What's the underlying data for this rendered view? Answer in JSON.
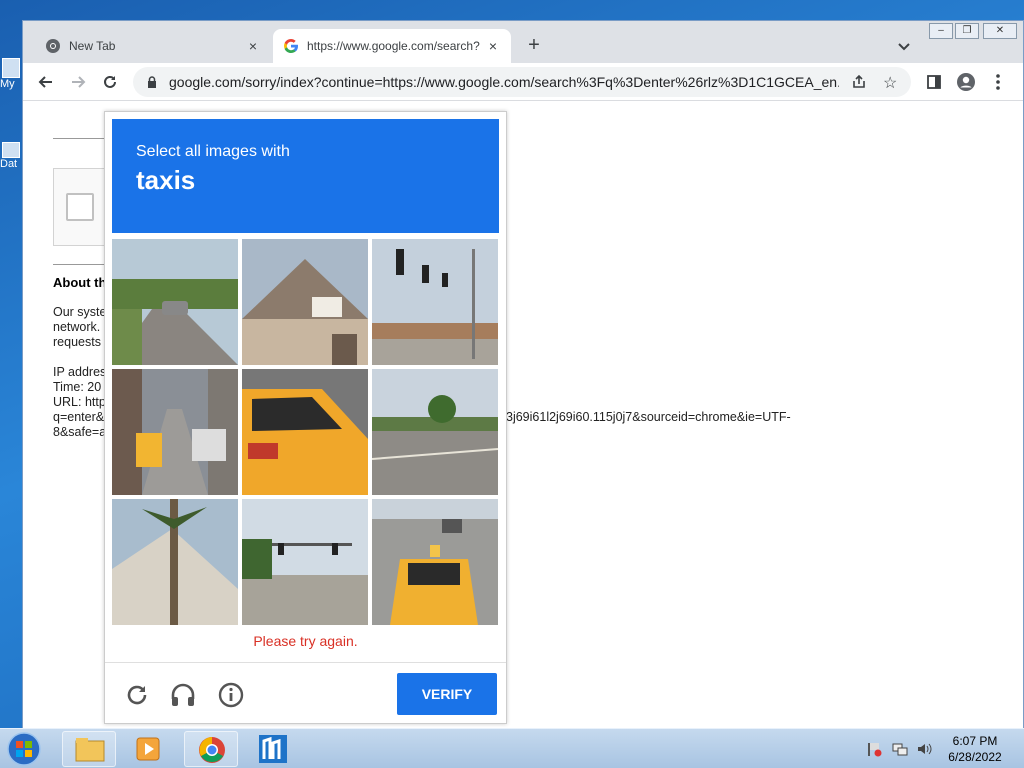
{
  "desktop": {
    "icons": [
      {
        "label": "My"
      },
      {
        "label": "Dat"
      }
    ]
  },
  "browser": {
    "tabs": [
      {
        "title": "New Tab",
        "icon": "chrome-icon"
      },
      {
        "title": "https://www.google.com/search?",
        "icon": "google-icon"
      }
    ],
    "new_tab_symbol": "+",
    "close_symbol": "×",
    "url": "google.com/sorry/index?continue=https://www.google.com/search%3Fq%3Denter%26rlz%3D1C1GCEA_en...",
    "window_controls": [
      "–",
      "❐",
      "✕"
    ]
  },
  "page": {
    "about_heading": "About th",
    "para_lines": [
      "Our syste",
      "network.",
      "requests"
    ],
    "info_lines": [
      "IP addres",
      "Time: 20",
      "URL: http",
      "q=enter&",
      "8&safe=a"
    ],
    "url_tail": "3j69i61l2j69i60.115j0j7&sourceid=chrome&ie=UTF-"
  },
  "captcha": {
    "instruction": "Select all images with",
    "object": "taxis",
    "error": "Please try again.",
    "verify_label": "VERIFY",
    "header_color": "#1a73e8",
    "tiles": [
      {
        "scene": "street with car"
      },
      {
        "scene": "house roof"
      },
      {
        "scene": "traffic lights"
      },
      {
        "scene": "city street with taxi"
      },
      {
        "scene": "taxi closeup"
      },
      {
        "scene": "road with trees"
      },
      {
        "scene": "palm tree house"
      },
      {
        "scene": "intersection traffic lights"
      },
      {
        "scene": "taxi on street"
      }
    ]
  },
  "taskbar": {
    "time": "6:07 PM",
    "date": "6/28/2022"
  }
}
